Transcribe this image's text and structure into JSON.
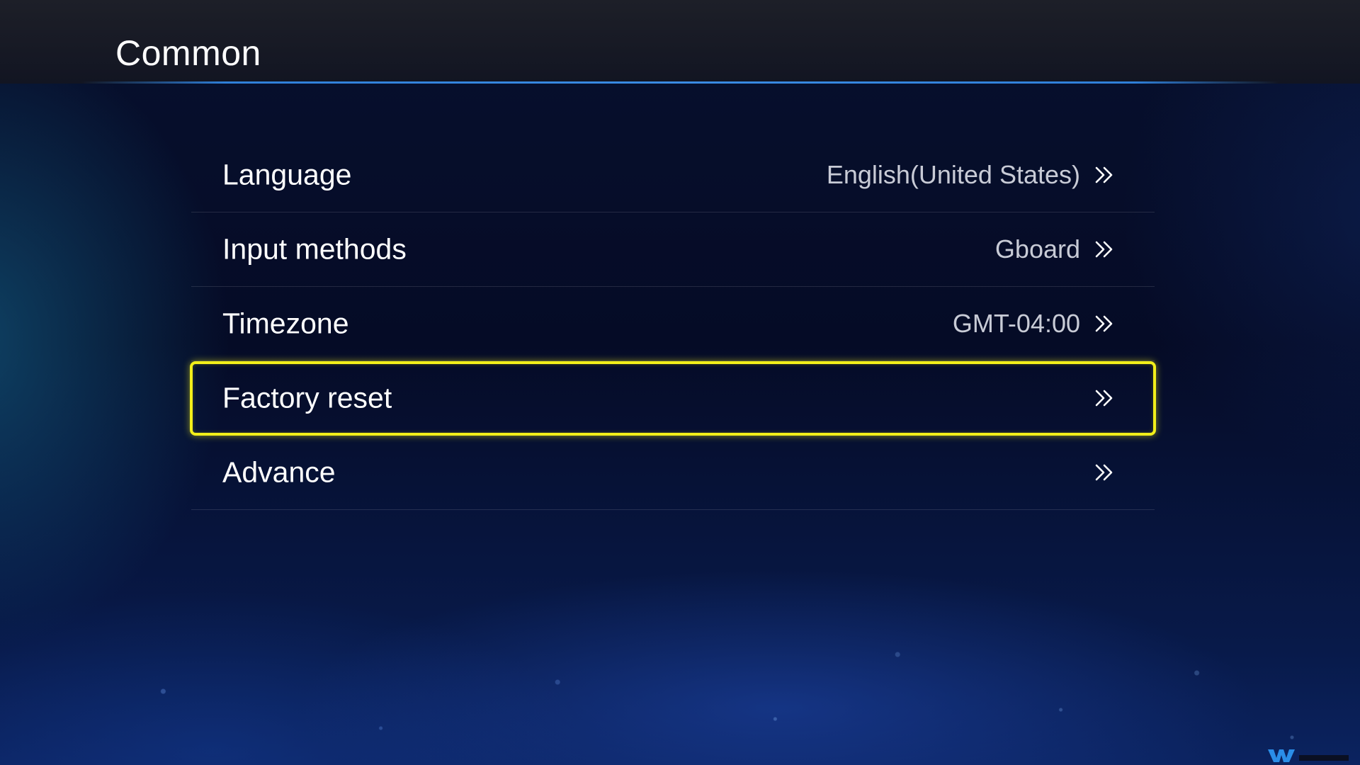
{
  "header": {
    "title": "Common"
  },
  "menu": {
    "items": [
      {
        "label": "Language",
        "value": "English(United States)",
        "icon": "double-chevron-right-icon"
      },
      {
        "label": "Input methods",
        "value": "Gboard",
        "icon": "double-chevron-right-icon"
      },
      {
        "label": "Timezone",
        "value": "GMT-04:00",
        "icon": "double-chevron-right-icon"
      },
      {
        "label": "Factory reset",
        "value": "",
        "icon": "double-chevron-right-icon",
        "focused": true
      },
      {
        "label": "Advance",
        "value": "",
        "icon": "double-chevron-right-icon"
      }
    ]
  },
  "colors": {
    "focus": "#f2ef1a",
    "accent_line": "#3a8be3",
    "value_text": "#c8cbd6"
  }
}
